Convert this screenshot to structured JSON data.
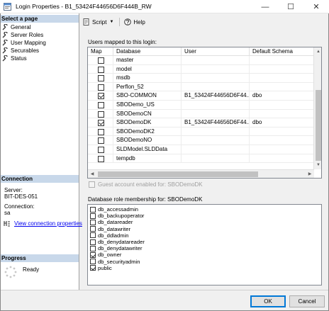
{
  "window": {
    "title": "Login Properties - B1_53424F44656D6F444B_RW",
    "min_glyph": "—",
    "max_glyph": "☐",
    "close_glyph": "✕"
  },
  "left_panel": {
    "select_page_heading": "Select a page",
    "pages": [
      {
        "label": "General",
        "icon": "wrench-icon"
      },
      {
        "label": "Server Roles",
        "icon": "wrench-icon"
      },
      {
        "label": "User Mapping",
        "icon": "wrench-icon"
      },
      {
        "label": "Securables",
        "icon": "wrench-icon"
      },
      {
        "label": "Status",
        "icon": "wrench-icon"
      }
    ],
    "connection_heading": "Connection",
    "server_label": "Server:",
    "server_value": "BIT-DES-051",
    "connection_label": "Connection:",
    "connection_value": "sa",
    "view_connection_properties": "View connection properties",
    "progress_heading": "Progress",
    "progress_status": "Ready"
  },
  "toolbar": {
    "script_label": "Script",
    "help_label": "Help"
  },
  "mapping": {
    "label": "Users mapped to this login:",
    "columns": [
      "Map",
      "Database",
      "User",
      "Default Schema"
    ],
    "rows": [
      {
        "map": false,
        "database": "master",
        "user": "",
        "schema": ""
      },
      {
        "map": false,
        "database": "model",
        "user": "",
        "schema": ""
      },
      {
        "map": false,
        "database": "msdb",
        "user": "",
        "schema": ""
      },
      {
        "map": false,
        "database": "Perflon_52",
        "user": "",
        "schema": ""
      },
      {
        "map": true,
        "database": "SBO-COMMON",
        "user": "B1_53424F44656D6F44...",
        "schema": "dbo"
      },
      {
        "map": false,
        "database": "SBODemo_US",
        "user": "",
        "schema": ""
      },
      {
        "map": false,
        "database": "SBODemoCN",
        "user": "",
        "schema": ""
      },
      {
        "map": true,
        "database": "SBODemoDK",
        "user": "B1_53424F44656D6F44...",
        "schema": "dbo"
      },
      {
        "map": false,
        "database": "SBODemoDK2",
        "user": "",
        "schema": ""
      },
      {
        "map": false,
        "database": "SBODemoNO",
        "user": "",
        "schema": ""
      },
      {
        "map": false,
        "database": "SLDModel.SLDData",
        "user": "",
        "schema": ""
      },
      {
        "map": false,
        "database": "tempdb",
        "user": "",
        "schema": ""
      }
    ],
    "guest_label": "Guest account enabled for: SBODemoDK"
  },
  "roles": {
    "label": "Database role membership for: SBODemoDK",
    "items": [
      {
        "name": "db_accessadmin",
        "checked": false
      },
      {
        "name": "db_backupoperator",
        "checked": false
      },
      {
        "name": "db_datareader",
        "checked": false
      },
      {
        "name": "db_datawriter",
        "checked": false
      },
      {
        "name": "db_ddladmin",
        "checked": false
      },
      {
        "name": "db_denydatareader",
        "checked": false
      },
      {
        "name": "db_denydatawriter",
        "checked": false
      },
      {
        "name": "db_owner",
        "checked": true
      },
      {
        "name": "db_securityadmin",
        "checked": false
      },
      {
        "name": "public",
        "checked": true
      }
    ]
  },
  "buttons": {
    "ok": "OK",
    "cancel": "Cancel"
  }
}
